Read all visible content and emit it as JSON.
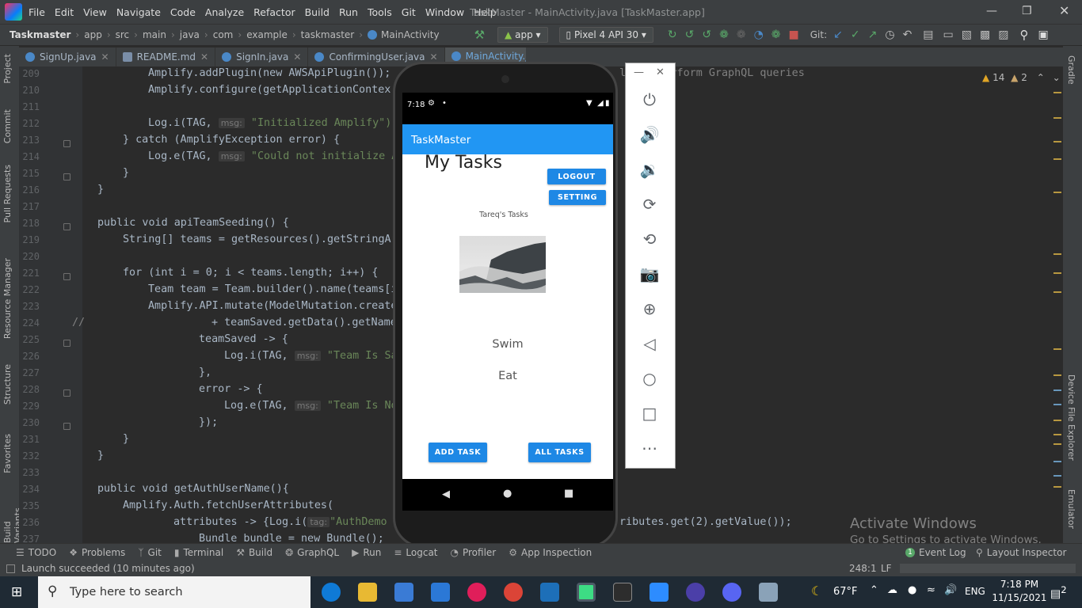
{
  "menu": {
    "items": [
      "File",
      "Edit",
      "View",
      "Navigate",
      "Code",
      "Analyze",
      "Refactor",
      "Build",
      "Run",
      "Tools",
      "Git",
      "Window",
      "Help"
    ],
    "window_title": "TaskMaster - MainActivity.java [TaskMaster.app]"
  },
  "breadcrumb": [
    "Taskmaster",
    "app",
    "src",
    "main",
    "java",
    "com",
    "example",
    "taskmaster",
    "MainActivity"
  ],
  "toolbar": {
    "module": "app",
    "device": "Pixel 4 API 30",
    "git_label": "Git:"
  },
  "tabs": [
    "SignUp.java",
    "README.md",
    "SignIn.java",
    "ConfirmingUser.java",
    "MainActivity.java"
  ],
  "left_tools": [
    "Project",
    "Commit",
    "Pull Requests",
    "Resource Manager",
    "Structure",
    "Favorites",
    "Build Variants"
  ],
  "right_tools": [
    "Gradle",
    "Device File Explorer",
    "Emulator"
  ],
  "inspections": {
    "warnings": "14",
    "weak": "2"
  },
  "line_numbers": [
    "209",
    "210",
    "211",
    "212",
    "213",
    "214",
    "215",
    "216",
    "217",
    "218",
    "219",
    "220",
    "221",
    "222",
    "223",
    "224",
    "225",
    "226",
    "227",
    "228",
    "229",
    "230",
    "231",
    "232",
    "233",
    "234",
    "235",
    "236",
    "237"
  ],
  "code_fragments": {
    "l209": "Amplify.addPlugin(new AWSApiPlugin());",
    "l209_right": "ll to perform GraphQL queries",
    "l210": "Amplify.configure(getApplicationContex",
    "l212a": "Log.i(TAG,",
    "l212b": "\"Initialized Amplify\")",
    "l213": "} catch (AmplifyException error) {",
    "l214a": "Log.e(TAG,",
    "l214b": "\"Could not initialize A",
    "l215": "}",
    "l216": "}",
    "l218": "public void apiTeamSeeding() {",
    "l219": "String[] teams = getResources().getStringAr",
    "l221": "for (int i = 0; i < teams.length; i++) {",
    "l222": "Team team = Team.builder().name(teams[i",
    "l223": "Amplify.API.mutate(ModelMutation.create",
    "l224a": "//",
    "l224b": "+ teamSaved.getData().getName",
    "l225": "teamSaved -> {",
    "l226a": "Log.i(TAG,",
    "l226b": "\"Team Is Sa",
    "l227": "},",
    "l228": "error -> {",
    "l229a": "Log.e(TAG,",
    "l229b": "\"Team Is No",
    "l230": "});",
    "l231": "}",
    "l232": "}",
    "l234": "public void getAuthUserName(){",
    "l235": "Amplify.Auth.fetchUserAttributes(",
    "l236a": "attributes -> {Log.i(",
    "l236b": "\"AuthDemo",
    "l236c": "ributes.get(2).getValue());",
    "l237": "Bundle bundle = new Bundle();",
    "hint_msg": "msg:",
    "hint_tag": "tag:"
  },
  "phone": {
    "time": "7:18",
    "app_title": "TaskMaster",
    "heading": "My Tasks",
    "logout": "LOGOUT",
    "setting": "SETTING",
    "user_tasks": "Tareq's Tasks",
    "tasks": [
      "Swim",
      "Eat"
    ],
    "add_task": "ADD TASK",
    "all_tasks": "ALL TASKS"
  },
  "bottom_tools": [
    "TODO",
    "Problems",
    "Git",
    "Terminal",
    "Build",
    "GraphQL",
    "Run",
    "Logcat",
    "Profiler",
    "App Inspection"
  ],
  "right_bottom_tools": [
    "Event Log",
    "Layout Inspector"
  ],
  "event_log_count": "1",
  "status": {
    "message": "Launch succeeded (10 minutes ago)",
    "position": "248:1",
    "line_sep": "LF"
  },
  "activate": {
    "title": "Activate Windows",
    "sub": "Go to Settings to activate Windows."
  },
  "taskbar": {
    "search_placeholder": "Type here to search",
    "temperature": "67°F",
    "lang": "ENG",
    "time": "7:18 PM",
    "date": "11/15/2021",
    "notifications": "2"
  },
  "colors": {
    "ide_bg": "#2b2b2b",
    "accent": "#2196f3",
    "button": "#1e88e5"
  }
}
